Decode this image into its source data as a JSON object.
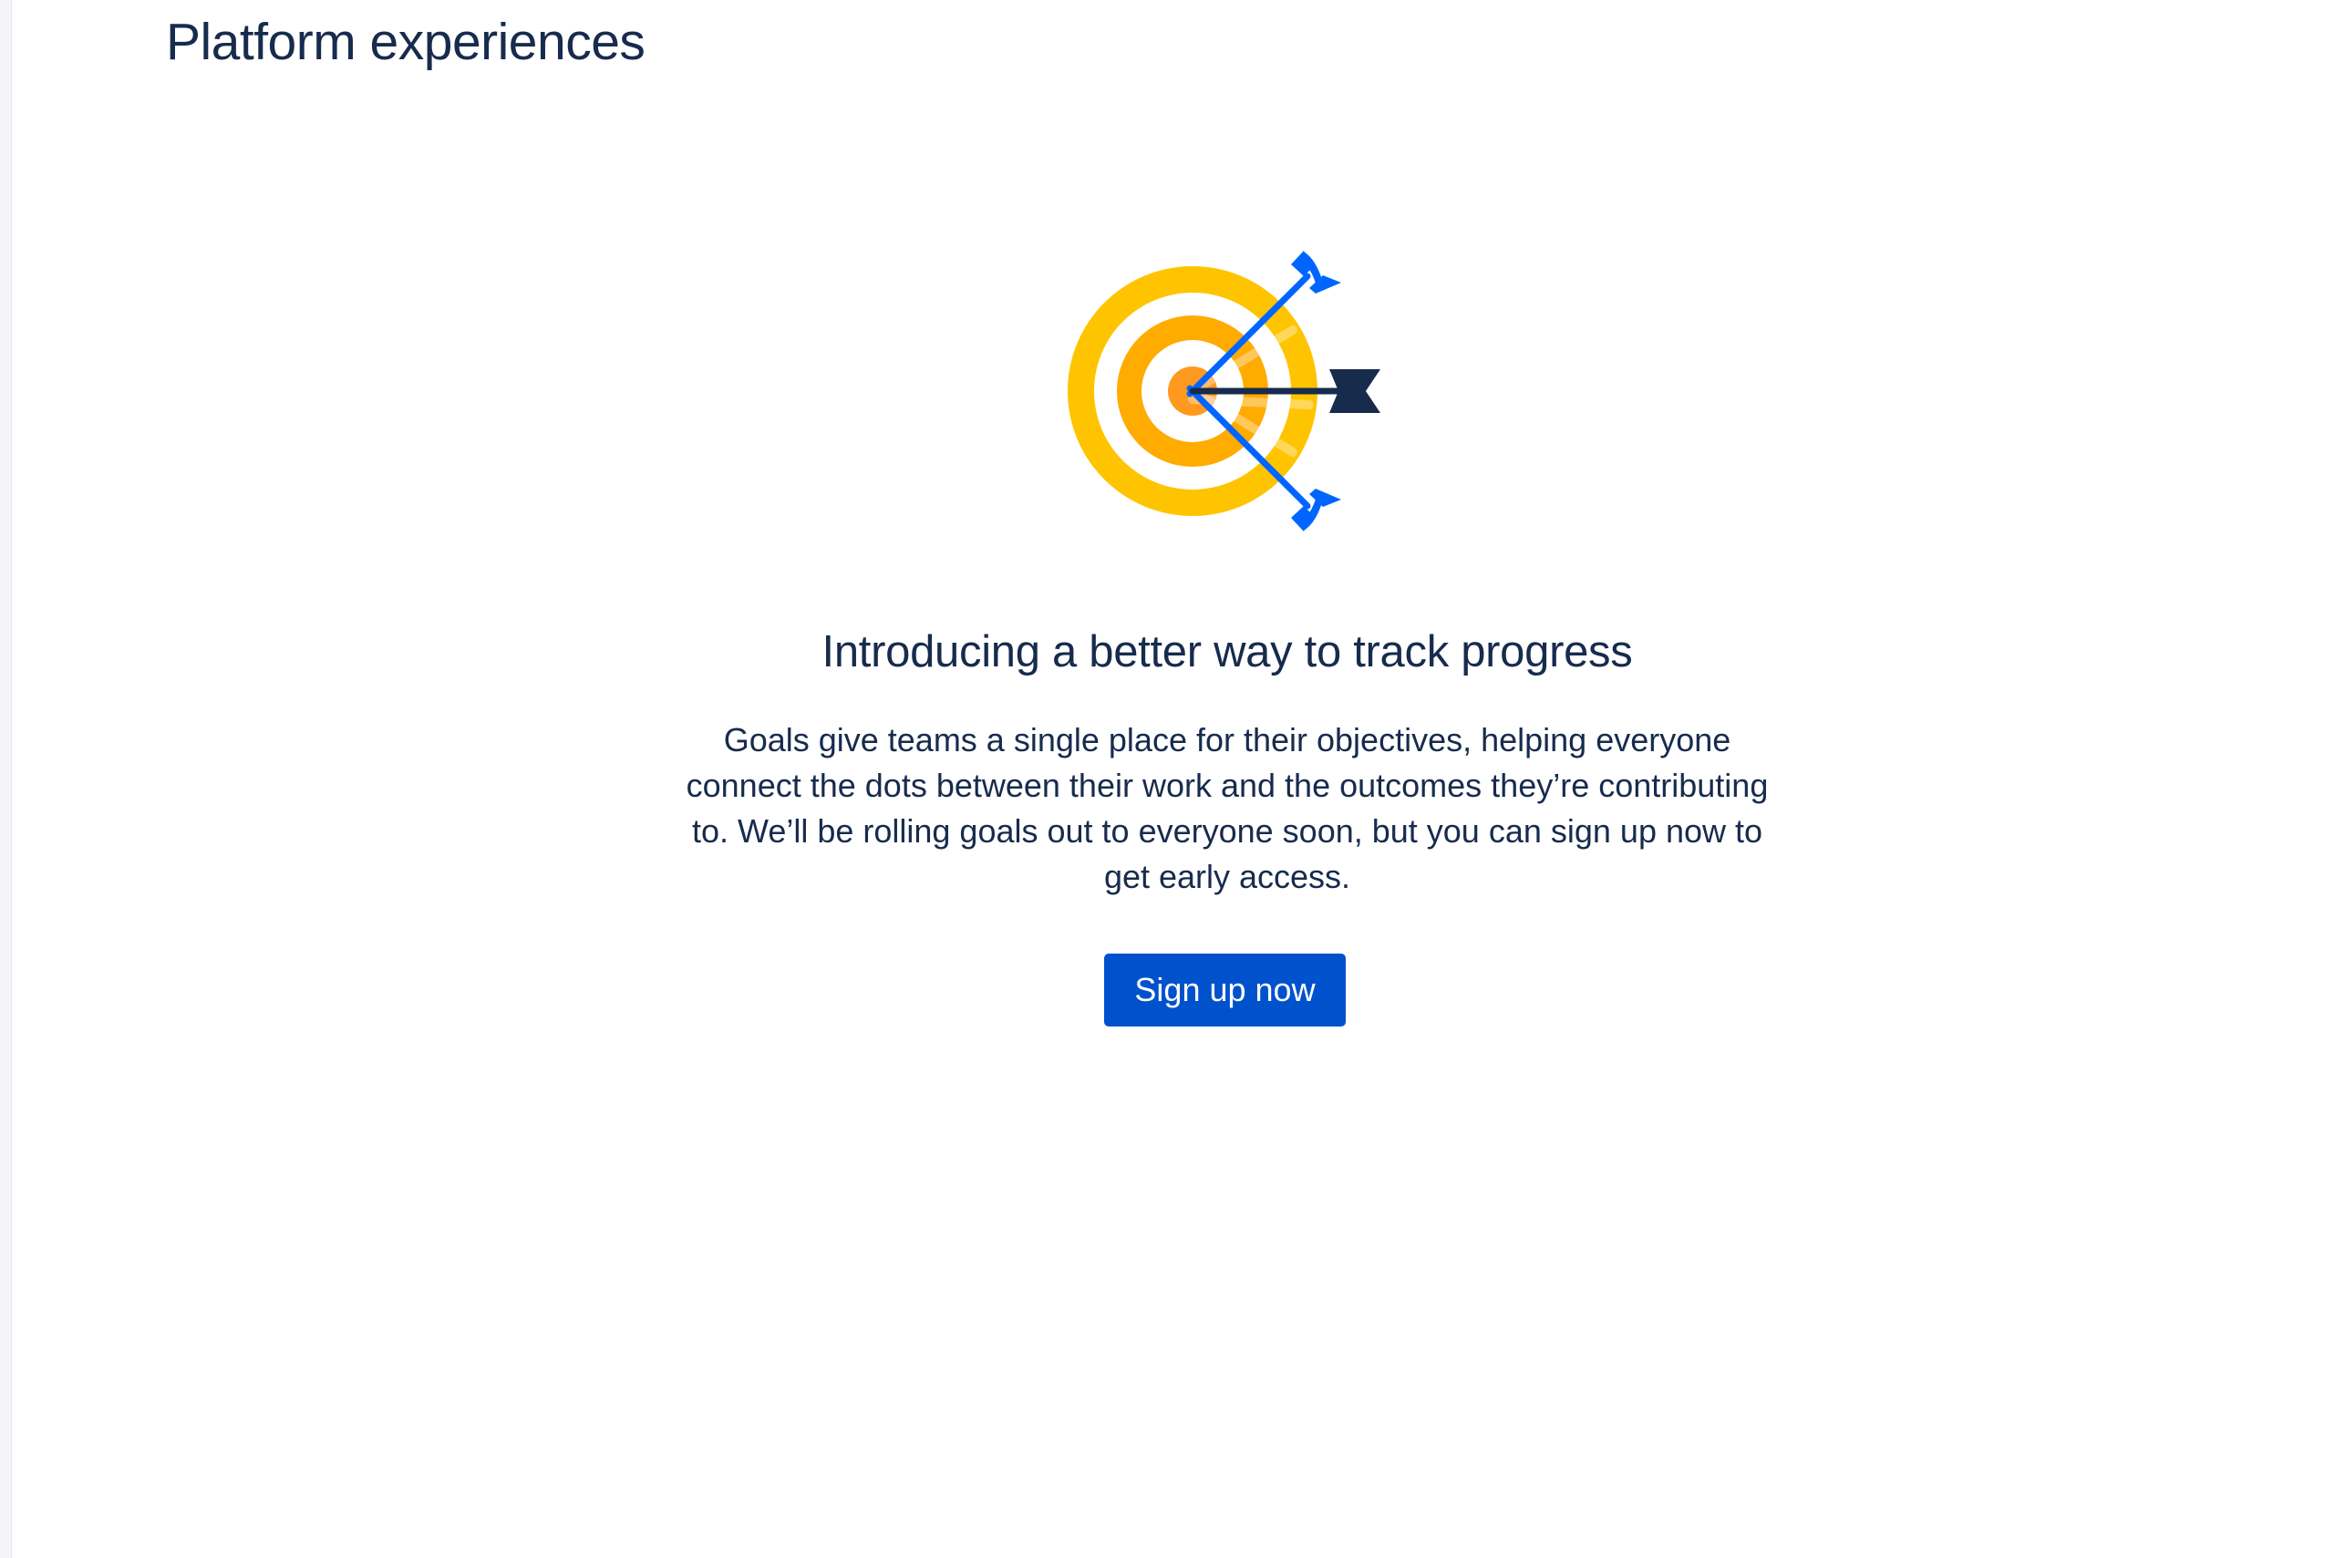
{
  "page": {
    "title": "Platform experiences"
  },
  "empty_state": {
    "illustration_icon": "target-with-arrows-icon",
    "heading": "Introducing a better way to track progress",
    "description": "Goals give teams a single place for their objectives, helping everyone connect the dots between their work and the outcomes they’re contributing to. We’ll be rolling goals out to everyone soon, but you can sign up now to get early access.",
    "cta_label": "Sign up now"
  },
  "colors": {
    "text_primary": "#172b4d",
    "brand_blue": "#0052cc",
    "arrow_blue": "#0065ff",
    "target_outer": "#ffc400",
    "target_middle": "#ffab00",
    "target_center": "#ff991f",
    "arrow_dark": "#172b4d"
  }
}
